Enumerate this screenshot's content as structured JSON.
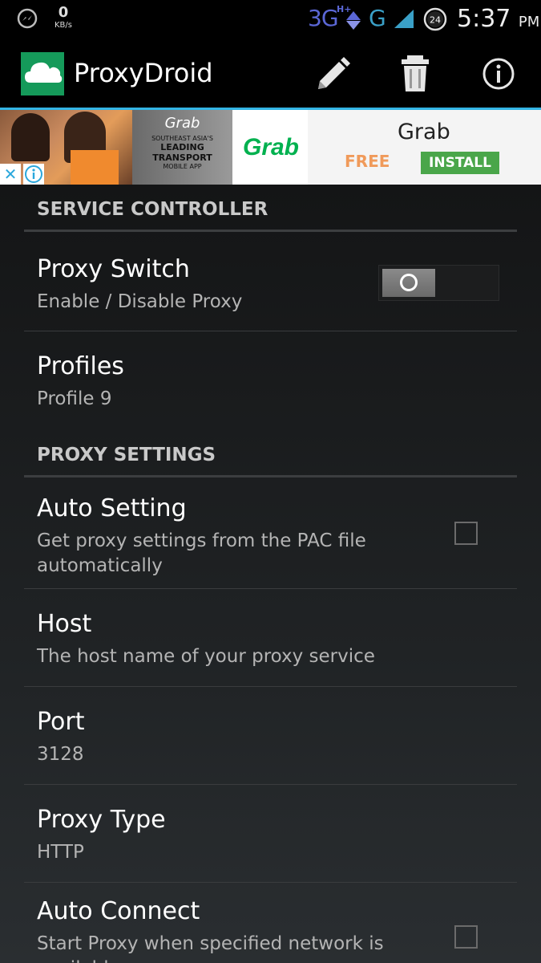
{
  "status_bar": {
    "speed_value": "0",
    "speed_unit": "KB/s",
    "network_type": "3G",
    "network_sub": "H+",
    "network_alt": "G",
    "battery_level": "24",
    "time": "5:37",
    "ampm": "PM"
  },
  "action_bar": {
    "title": "ProxyDroid",
    "icons": [
      "cloud-icon",
      "edit-icon",
      "trash-icon",
      "info-icon"
    ]
  },
  "ad": {
    "banner_brand": "Grab",
    "banner_line1": "SOUTHEAST ASIA'S",
    "banner_line2": "LEADING TRANSPORT",
    "banner_line3": "MOBILE APP",
    "logo_text": "Grab",
    "app_name": "Grab",
    "price": "FREE",
    "install_label": "INSTALL",
    "close_glyph": "✕",
    "colors": {
      "install": "#4aa64a",
      "free": "#f09a5a",
      "logo": "#00b14f"
    }
  },
  "service_controller": {
    "header": "SERVICE CONTROLLER",
    "proxy_switch": {
      "title": "Proxy Switch",
      "summary": "Enable / Disable Proxy",
      "enabled": false
    },
    "profiles": {
      "title": "Profiles",
      "summary": "Profile 9"
    }
  },
  "proxy_settings": {
    "header": "PROXY SETTINGS",
    "auto_setting": {
      "title": "Auto Setting",
      "summary": "Get proxy settings from the PAC file automatically",
      "checked": false
    },
    "host": {
      "title": "Host",
      "summary": "The host name of your proxy service"
    },
    "port": {
      "title": "Port",
      "summary": "3128"
    },
    "proxy_type": {
      "title": "Proxy Type",
      "summary": "HTTP"
    },
    "auto_connect": {
      "title": "Auto Connect",
      "summary": "Start Proxy when specified network is available",
      "checked": false
    }
  },
  "accent_color": "#33b5e5"
}
